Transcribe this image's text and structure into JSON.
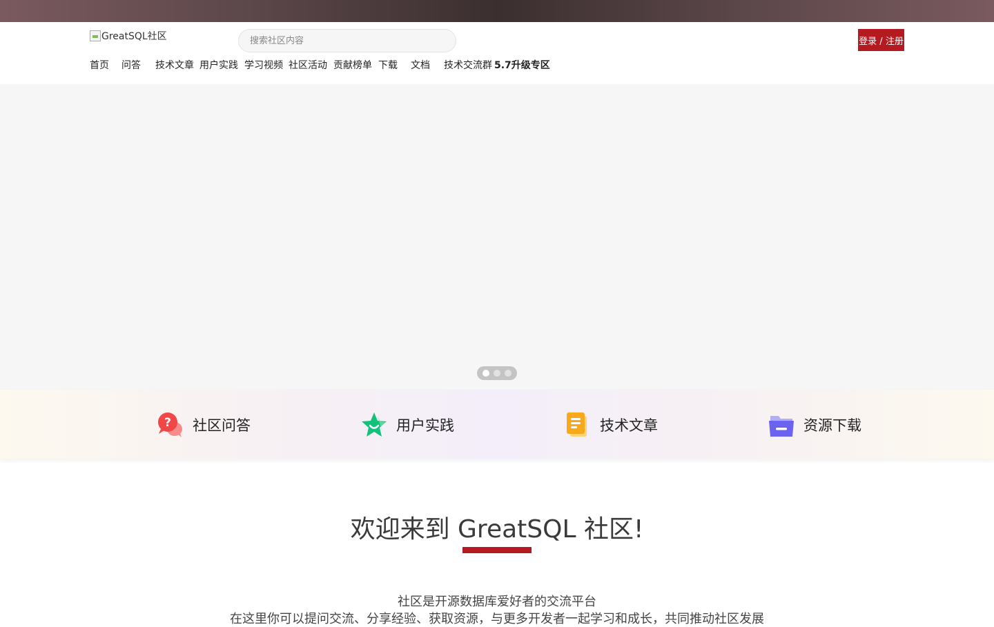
{
  "header": {
    "logo_alt": "GreatSQL社区",
    "search_placeholder": "搜索社区内容",
    "login_label": "登录 / 注册"
  },
  "nav": {
    "items": [
      {
        "label": "首页"
      },
      {
        "label": "问答"
      },
      {
        "label": "技术文章"
      },
      {
        "label": "用户实践"
      },
      {
        "label": "学习视频"
      },
      {
        "label": "社区活动"
      },
      {
        "label": "贡献榜单"
      },
      {
        "label": "下载"
      },
      {
        "label": "文档"
      },
      {
        "label": "技术交流群"
      },
      {
        "label": "5.7升级专区"
      }
    ]
  },
  "carousel": {
    "slide_count": 3,
    "active_index": 0
  },
  "features": [
    {
      "label": "社区问答",
      "icon": "question-chat-icon",
      "color": "#f04848"
    },
    {
      "label": "用户实践",
      "icon": "star-icon",
      "color": "#14c17a"
    },
    {
      "label": "技术文章",
      "icon": "document-icon",
      "color": "#f7a81b"
    },
    {
      "label": "资源下载",
      "icon": "folder-icon",
      "color": "#6a63f0"
    }
  ],
  "welcome": {
    "title": "欢迎来到 GreatSQL 社区!",
    "line1": "社区是开源数据库爱好者的交流平台",
    "line2": "在这里你可以提问交流、分享经验、获取资源，与更多开发者一起学习和成长，共同推动社区发展"
  },
  "colors": {
    "accent": "#b61a21",
    "hero_bg": "#f6f6f6"
  }
}
